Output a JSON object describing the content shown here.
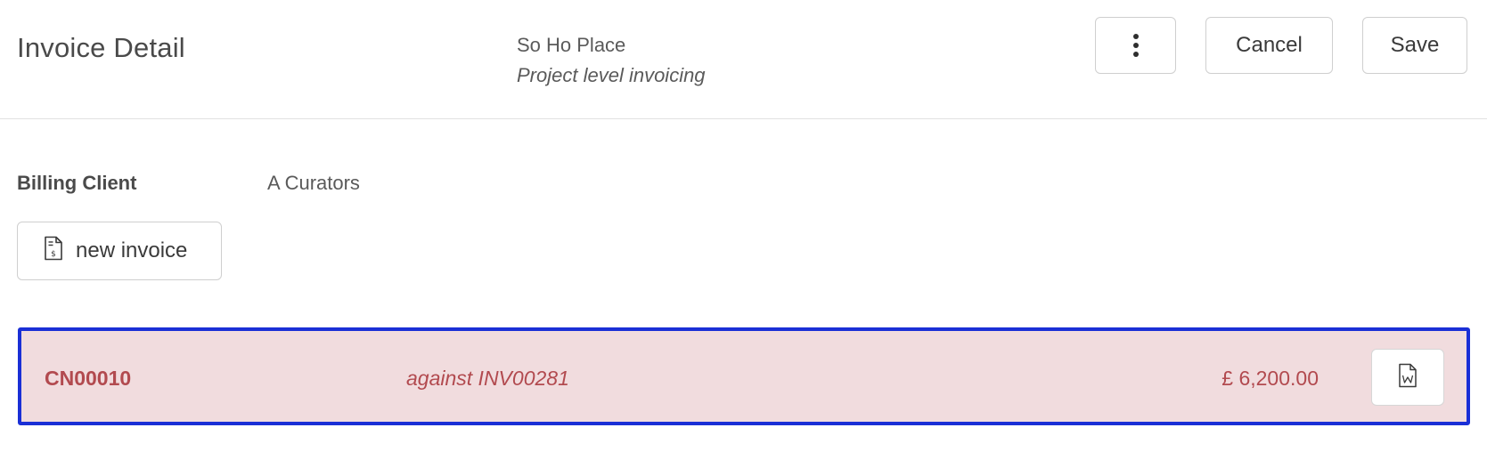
{
  "header": {
    "title": "Invoice Detail",
    "project_name": "So Ho Place",
    "project_subtitle": "Project level invoicing",
    "more_icon": "kebab-menu-icon",
    "cancel_label": "Cancel",
    "save_label": "Save"
  },
  "billing": {
    "label": "Billing Client",
    "value": "A Curators"
  },
  "new_invoice": {
    "label": "new invoice",
    "icon": "invoice-dollar-icon"
  },
  "credit_note": {
    "id": "CN00010",
    "against": "against INV00281",
    "amount": "£ 6,200.00",
    "doc_icon": "word-document-icon"
  },
  "colors": {
    "highlight_border": "#1a2fd6",
    "row_background": "#f1dcde",
    "row_text": "#b24a4f"
  }
}
